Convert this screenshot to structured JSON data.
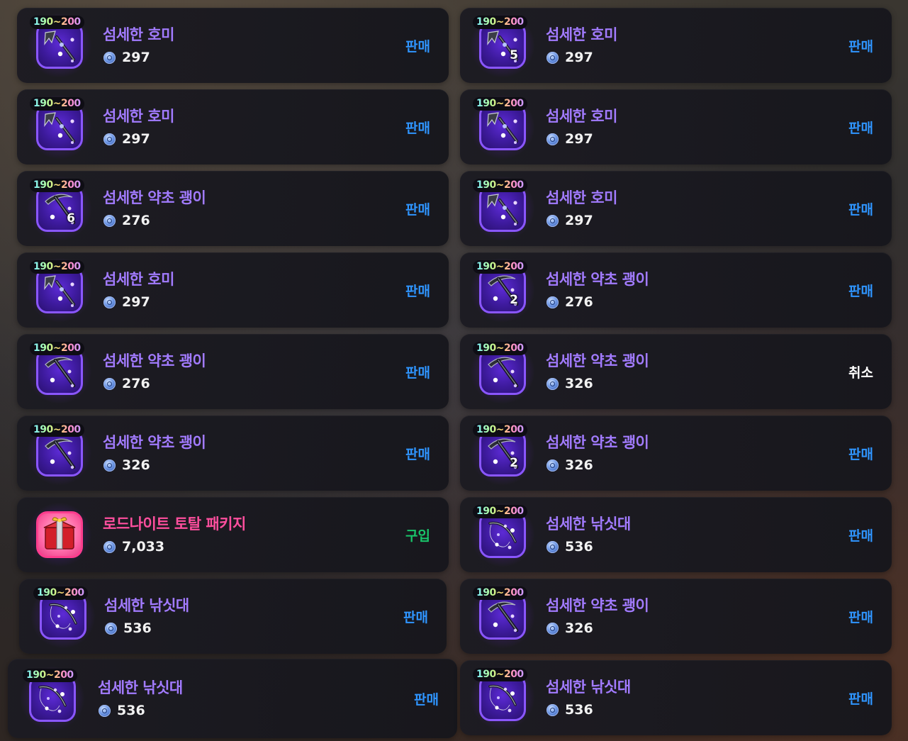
{
  "colors": {
    "item_name": "#a27bff",
    "package_name": "#ff4f9e",
    "sell_action": "#2f95ff",
    "buy_action": "#19c46a",
    "cancel_action": "#ffffff",
    "card_bg": "#1c1b22",
    "icon_border_purple": "#8a56ff",
    "icon_border_pink": "#ff3d8e"
  },
  "currency_icon": "blue-coin-icon",
  "left_column": [
    {
      "level": "190~200",
      "name": "섬세한 호미",
      "price": "297",
      "qty": "",
      "action": "판매",
      "action_type": "sell",
      "icon": "hoe-icon"
    },
    {
      "level": "190~200",
      "name": "섬세한 호미",
      "price": "297",
      "qty": "",
      "action": "판매",
      "action_type": "sell",
      "icon": "hoe-icon"
    },
    {
      "level": "190~200",
      "name": "섬세한 약초 괭이",
      "price": "276",
      "qty": "6",
      "action": "판매",
      "action_type": "sell",
      "icon": "pickaxe-icon"
    },
    {
      "level": "190~200",
      "name": "섬세한 호미",
      "price": "297",
      "qty": "",
      "action": "판매",
      "action_type": "sell",
      "icon": "hoe-icon"
    },
    {
      "level": "190~200",
      "name": "섬세한 약초 괭이",
      "price": "276",
      "qty": "",
      "action": "판매",
      "action_type": "sell",
      "icon": "pickaxe-icon"
    },
    {
      "level": "190~200",
      "name": "섬세한 약초 괭이",
      "price": "326",
      "qty": "",
      "action": "판매",
      "action_type": "sell",
      "icon": "pickaxe-icon"
    },
    {
      "level": "",
      "name": "로드나이트 토탈 패키지",
      "price": "7,033",
      "qty": "",
      "action": "구입",
      "action_type": "buy",
      "icon": "gift-chest-icon"
    },
    {
      "level": "190~200",
      "name": "섬세한 낚싯대",
      "price": "536",
      "qty": "",
      "action": "판매",
      "action_type": "sell",
      "icon": "fishing-rod-icon"
    },
    {
      "level": "190~200",
      "name": "섬세한 낚싯대",
      "price": "536",
      "qty": "",
      "action": "판매",
      "action_type": "sell",
      "icon": "fishing-rod-icon"
    }
  ],
  "right_column": [
    {
      "level": "190~200",
      "name": "섬세한 호미",
      "price": "297",
      "qty": "5",
      "action": "판매",
      "action_type": "sell",
      "icon": "hoe-icon"
    },
    {
      "level": "190~200",
      "name": "섬세한 호미",
      "price": "297",
      "qty": "",
      "action": "판매",
      "action_type": "sell",
      "icon": "hoe-icon"
    },
    {
      "level": "190~200",
      "name": "섬세한 호미",
      "price": "297",
      "qty": "",
      "action": "판매",
      "action_type": "sell",
      "icon": "hoe-icon"
    },
    {
      "level": "190~200",
      "name": "섬세한 약초 괭이",
      "price": "276",
      "qty": "2",
      "action": "판매",
      "action_type": "sell",
      "icon": "pickaxe-icon"
    },
    {
      "level": "190~200",
      "name": "섬세한 약초 괭이",
      "price": "326",
      "qty": "",
      "action": "취소",
      "action_type": "cancel",
      "icon": "pickaxe-icon"
    },
    {
      "level": "190~200",
      "name": "섬세한 약초 괭이",
      "price": "326",
      "qty": "2",
      "action": "판매",
      "action_type": "sell",
      "icon": "pickaxe-icon"
    },
    {
      "level": "190~200",
      "name": "섬세한 낚싯대",
      "price": "536",
      "qty": "",
      "action": "판매",
      "action_type": "sell",
      "icon": "fishing-rod-icon"
    },
    {
      "level": "190~200",
      "name": "섬세한 약초 괭이",
      "price": "326",
      "qty": "",
      "action": "판매",
      "action_type": "sell",
      "icon": "pickaxe-icon"
    },
    {
      "level": "190~200",
      "name": "섬세한 낚싯대",
      "price": "536",
      "qty": "",
      "action": "판매",
      "action_type": "sell",
      "icon": "fishing-rod-icon"
    }
  ]
}
